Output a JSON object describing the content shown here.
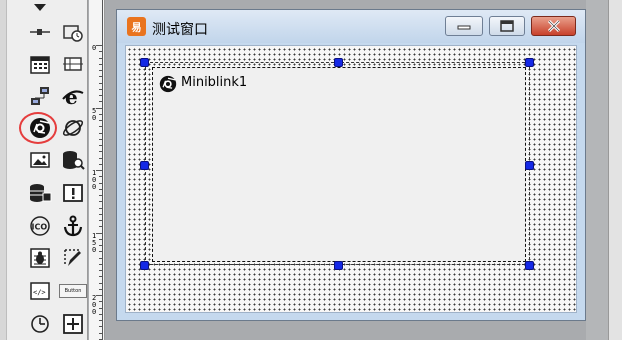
{
  "window": {
    "title": "测试窗口",
    "icon_text": "易",
    "icon_name": "app-icon"
  },
  "control": {
    "label": "Miniblink1",
    "icon_name": "miniblink-icon"
  },
  "toolbox": {
    "items": [
      {
        "name": "down-arrow-icon"
      },
      {
        "name": "line-icon"
      },
      {
        "name": "timer-icon"
      },
      {
        "name": "calendar-icon"
      },
      {
        "name": "tab-control-icon"
      },
      {
        "name": "network-icon"
      },
      {
        "name": "ie-browser-icon"
      },
      {
        "name": "miniblink-browser-icon",
        "selected": true
      },
      {
        "name": "planet-icon"
      },
      {
        "name": "image-icon"
      },
      {
        "name": "database-search-icon"
      },
      {
        "name": "database-edit-icon"
      },
      {
        "name": "alert-icon"
      },
      {
        "name": "ico-icon"
      },
      {
        "name": "anchor-icon"
      },
      {
        "name": "bug-icon"
      },
      {
        "name": "pen-icon"
      },
      {
        "name": "html-code-icon"
      },
      {
        "name": "button-icon",
        "text": "Button"
      },
      {
        "name": "clock-icon"
      },
      {
        "name": "plus-box-icon"
      }
    ]
  },
  "ruler": {
    "labels": [
      "0",
      "50",
      "100",
      "150",
      "200"
    ]
  },
  "colors": {
    "selection_handle": "#1428e6",
    "highlight_ring": "#e53d3d",
    "close_button": "#c8412b"
  }
}
